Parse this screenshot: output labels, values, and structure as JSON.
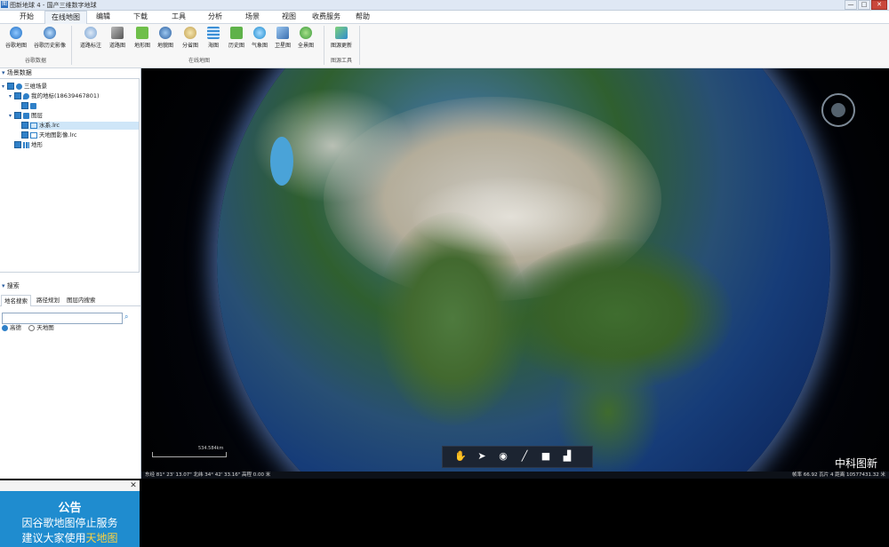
{
  "window": {
    "app_icon_text": "图",
    "title": "图新地球 4 - 国产三维数字地球",
    "buttons": [
      "—",
      "□",
      "✕"
    ]
  },
  "menu": {
    "tabs": [
      "开始",
      "在线地图",
      "编辑",
      "下载",
      "工具",
      "分析",
      "场景",
      "视图",
      "收费服务",
      "帮助"
    ],
    "active": "在线地图"
  },
  "ribbon": {
    "google_buttons": [
      "谷歌地图",
      "谷歌历史影像"
    ],
    "google_group": "谷歌数据",
    "online_buttons": [
      "道路标注",
      "道路图",
      "地形图",
      "地貌图",
      "分省图",
      "海图",
      "历史图",
      "气象图",
      "卫星图",
      "全景图"
    ],
    "online_group": "在线地图",
    "tool_buttons": [
      "图源更新"
    ],
    "tool_group": "图源工具"
  },
  "scene_panel": {
    "header": "场景数据",
    "tree": [
      {
        "label": "三维场景"
      },
      {
        "label": "我的地标(18639467801)"
      },
      {
        "label": ""
      },
      {
        "label": "图层"
      },
      {
        "label": "水系.lrc"
      },
      {
        "label": "天地图影像.lrc"
      },
      {
        "label": "地形"
      }
    ]
  },
  "search_panel": {
    "header": "搜索",
    "tabs": [
      "地名搜索",
      "路径规划",
      "图层内搜索"
    ],
    "input_placeholder": "",
    "options": [
      "高德",
      "天地图"
    ],
    "selected_option": "高德"
  },
  "notice": {
    "close": "✕",
    "title": "公告",
    "line1": "因谷歌地图停止服务",
    "line2_prefix": "建议大家使用",
    "line2_highlight": "天地图"
  },
  "map": {
    "scale_label": "534.584km",
    "watermark": "中科图新",
    "status_left": "东经 81° 23' 13.07\"  北纬 34° 42' 33.16\"  高程 0.00 米",
    "status_right": "帧率 66.92  瓦片 4  距离 10577431.32 米",
    "tools": [
      "hand-icon",
      "pointer-icon",
      "placemark-icon",
      "line-icon",
      "polygon-icon",
      "chart-icon"
    ]
  }
}
